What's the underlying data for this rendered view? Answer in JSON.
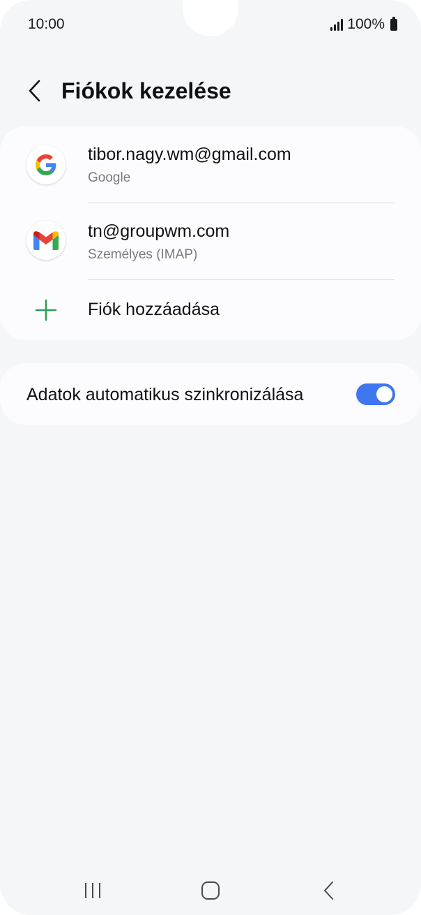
{
  "status_bar": {
    "time": "10:00",
    "battery": "100%",
    "signal_icon": "signal-icon",
    "battery_icon": "battery-icon"
  },
  "header": {
    "title": "Fiókok kezelése",
    "back_icon": "chevron-left-icon"
  },
  "accounts": [
    {
      "email": "tibor.nagy.wm@gmail.com",
      "type": "Google",
      "icon": "google-icon"
    },
    {
      "email": "tn@groupwm.com",
      "type": "Személyes (IMAP)",
      "icon": "gmail-icon"
    }
  ],
  "add_account": {
    "label": "Fiók hozzáadása",
    "icon": "plus-icon",
    "icon_color": "#2e9e5b"
  },
  "sync": {
    "label": "Adatok automatikus szinkronizálása",
    "enabled": true,
    "toggle_color": "#3e76f0"
  },
  "nav_bar": {
    "recents_icon": "recents-icon",
    "home_icon": "home-icon",
    "back_icon": "back-icon"
  }
}
